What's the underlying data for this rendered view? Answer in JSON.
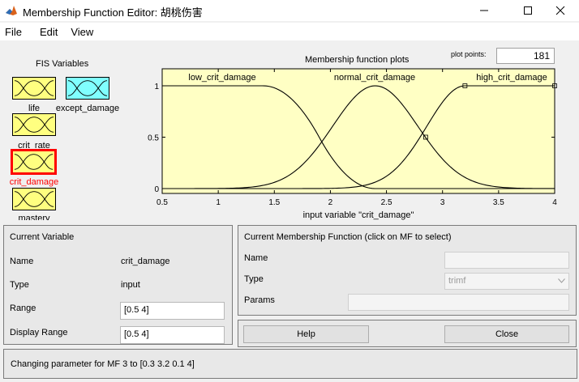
{
  "window": {
    "title": "Membership Function Editor: 胡桃伤害"
  },
  "menu": {
    "items": [
      "File",
      "Edit",
      "View"
    ]
  },
  "fis": {
    "title": "FIS Variables",
    "variables": [
      {
        "name": "life",
        "kind": "input"
      },
      {
        "name": "except_damage",
        "kind": "output"
      },
      {
        "name": "crit_rate",
        "kind": "input"
      },
      {
        "name": "crit_damage",
        "kind": "input",
        "selected": true
      },
      {
        "name": "mastery",
        "kind": "input"
      }
    ]
  },
  "plot": {
    "title": "Membership function plots",
    "plot_points_label": "plot points:",
    "plot_points_value": "181",
    "xlabel": "input variable \"crit_damage\"",
    "mf_labels": [
      "low_crit_damage",
      "normal_crit_damage",
      "high_crit_damage"
    ],
    "x_ticks": [
      "0.5",
      "1",
      "1.5",
      "2",
      "2.5",
      "3",
      "3.5",
      "4"
    ],
    "y_ticks": [
      "0",
      "0.5",
      "1"
    ]
  },
  "chart_data": {
    "type": "line",
    "xlabel": "input variable \"crit_damage\"",
    "xlim": [
      0.5,
      4
    ],
    "ylim": [
      0,
      1
    ],
    "x_ticks": [
      0.5,
      1,
      1.5,
      2,
      2.5,
      3,
      3.5,
      4
    ],
    "y_ticks": [
      0,
      0.5,
      1
    ],
    "series": [
      {
        "name": "low_crit_damage",
        "shape": "zmf",
        "params": [
          1.4,
          2.4
        ]
      },
      {
        "name": "normal_crit_damage",
        "shape": "gaussmf",
        "params": [
          0.38,
          2.4
        ]
      },
      {
        "name": "high_crit_damage",
        "shape": "trimf",
        "params": [
          0.3,
          3.2,
          0.1
        ]
      }
    ]
  },
  "current_variable": {
    "title": "Current Variable",
    "name_label": "Name",
    "name_value": "crit_damage",
    "type_label": "Type",
    "type_value": "input",
    "range_label": "Range",
    "range_value": "[0.5 4]",
    "display_range_label": "Display Range",
    "display_range_value": "[0.5 4]"
  },
  "current_mf": {
    "title": "Current Membership Function (click on MF to select)",
    "name_label": "Name",
    "name_value": "",
    "type_label": "Type",
    "type_value": "trimf",
    "params_label": "Params",
    "params_value": ""
  },
  "buttons": {
    "help": "Help",
    "close": "Close"
  },
  "status": {
    "text": "Changing parameter for MF 3 to  [0.3 3.2 0.1 4]"
  },
  "colors": {
    "plot_bg": "#ffffc4",
    "input_var": "#ffff80",
    "output_var": "#80ffff",
    "selected_border": "#ff0000"
  }
}
